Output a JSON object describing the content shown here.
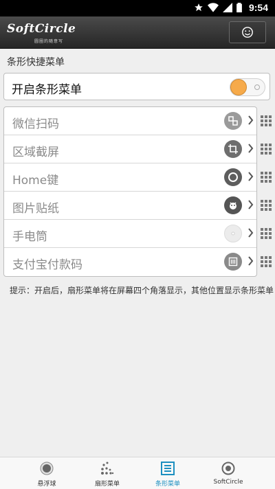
{
  "status_bar": {
    "time": "9:54",
    "icons": [
      "star-icon",
      "wifi-icon",
      "signal-icon",
      "battery-icon"
    ]
  },
  "app_bar": {
    "logo": "SoftCircle",
    "logo_subtitle": "圆圈的随意写",
    "action_icon": "smiley-icon"
  },
  "section_title": "条形快捷菜单",
  "toggle": {
    "label": "开启条形菜单",
    "on": true,
    "knob_color": "#f6aa4a"
  },
  "menu_items": [
    {
      "label": "微信扫码",
      "icon": "wechat-scan-icon"
    },
    {
      "label": "区域截屏",
      "icon": "crop-icon"
    },
    {
      "label": "Home键",
      "icon": "home-circle-icon"
    },
    {
      "label": "图片贴纸",
      "icon": "sticker-icon"
    },
    {
      "label": "手电筒",
      "icon": "flashlight-icon"
    },
    {
      "label": "支付宝付款码",
      "icon": "payment-code-icon"
    }
  ],
  "tip": "提示：开启后，扇形菜单将在屏幕四个角落显示，其他位置显示条形菜单",
  "bottom_nav": [
    {
      "label": "悬浮球",
      "icon": "floating-ball-icon",
      "active": false
    },
    {
      "label": "扇形菜单",
      "icon": "fan-menu-icon",
      "active": false
    },
    {
      "label": "条形菜单",
      "icon": "bar-menu-icon",
      "active": true
    },
    {
      "label": "SoftCircle",
      "icon": "softcircle-icon",
      "active": false
    }
  ],
  "colors": {
    "accent": "#1c8fc0",
    "appbar": "#333333",
    "toggle_knob": "#f6aa4a"
  }
}
